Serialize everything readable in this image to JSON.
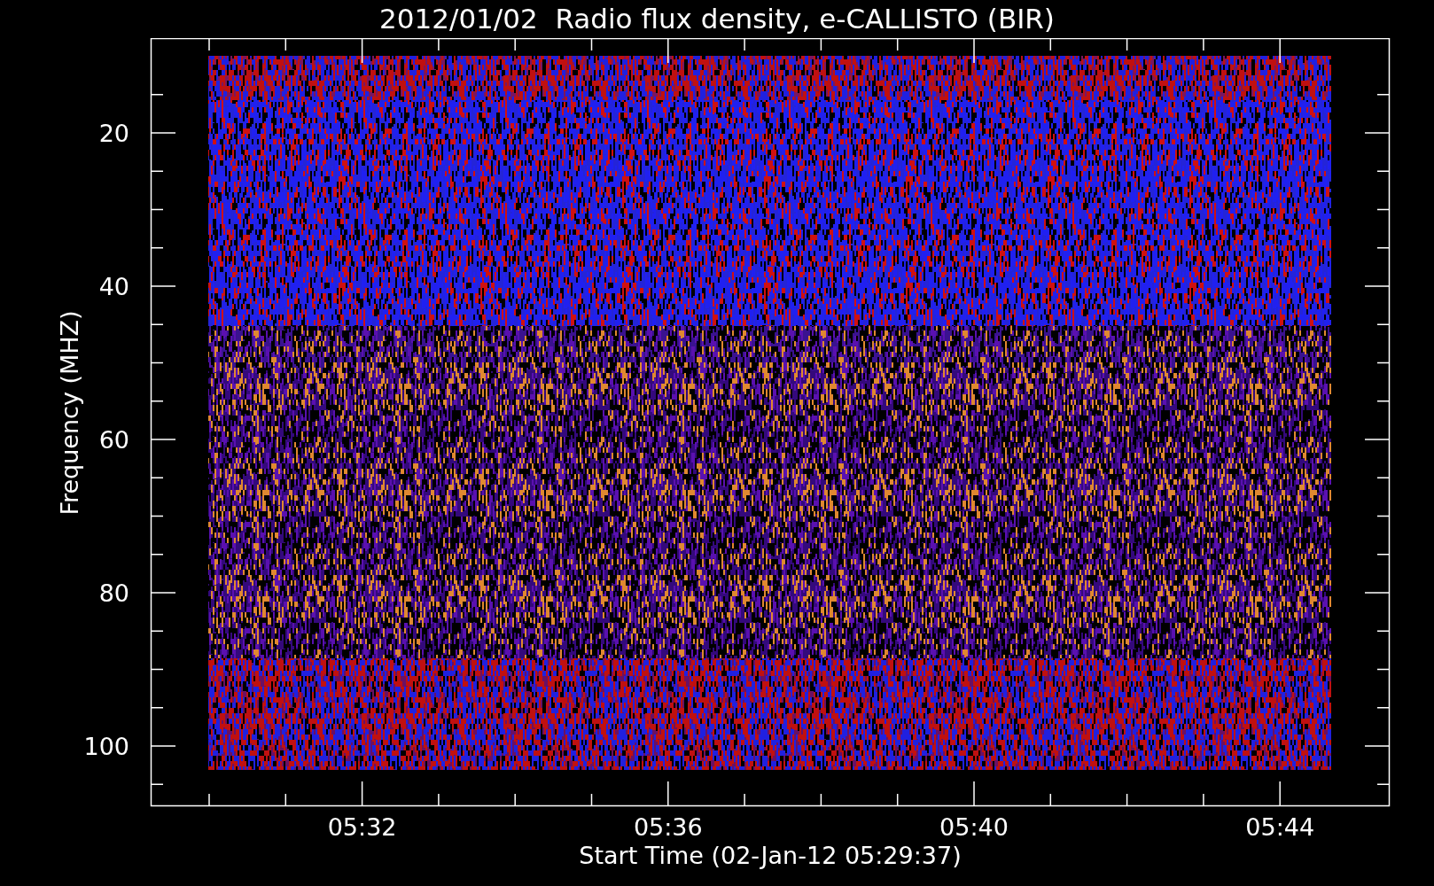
{
  "title": "2012/01/02  Radio flux density, e-CALLISTO (BIR)",
  "plot": {
    "ylabel": "Frequency (MHZ)",
    "xlabel": "Start Time (02-Jan-12 05:29:37)",
    "y_tick_labels": [
      "20",
      "40",
      "60",
      "80",
      "100"
    ],
    "x_tick_labels": [
      "05:32",
      "05:36",
      "05:40",
      "05:44"
    ]
  }
}
